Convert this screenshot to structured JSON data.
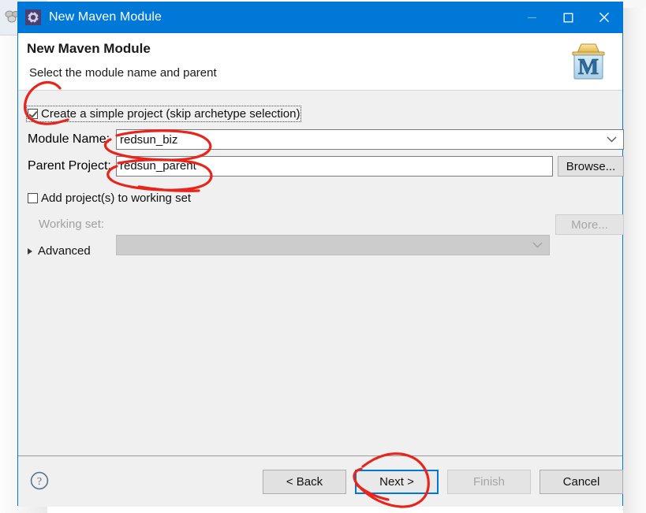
{
  "window": {
    "title": "New Maven Module",
    "title_icon": "gear-icon",
    "minimize_label": "—",
    "maximize_label": "□",
    "close_label": "✕"
  },
  "header": {
    "title": "New Maven Module",
    "subtitle": "Select the module name and parent",
    "logo_letter": "M",
    "logo_name": "maven-logo-icon"
  },
  "form": {
    "simple_project": {
      "label": "Create a simple project (skip archetype selection)",
      "checked": true,
      "focused": true
    },
    "module_name": {
      "label": "Module Name:",
      "value": "redsun_biz"
    },
    "parent_project": {
      "label": "Parent Project:",
      "value": "redsun_parent",
      "browse_label": "Browse..."
    },
    "working_set_checkbox": {
      "label": "Add project(s) to working set",
      "checked": false
    },
    "working_set": {
      "label": "Working set:",
      "value": "",
      "more_label": "More...",
      "enabled": false
    },
    "advanced": {
      "label": "Advanced",
      "expanded": false
    }
  },
  "footer": {
    "help_label": "?",
    "buttons": [
      {
        "label": "< Back",
        "name": "back-button",
        "enabled": true,
        "focused": false
      },
      {
        "label": "Next >",
        "name": "next-button",
        "enabled": true,
        "focused": true
      },
      {
        "label": "Finish",
        "name": "finish-button",
        "enabled": false,
        "focused": false
      },
      {
        "label": "Cancel",
        "name": "cancel-button",
        "enabled": true,
        "focused": false
      }
    ]
  },
  "colors": {
    "titlebar": "#0078d7",
    "accent": "#0078d7",
    "dialog_bg": "#f0f0f0",
    "annotation": "#e8251d"
  },
  "annotations": {
    "color": "#e8251d",
    "marks": [
      {
        "name": "circle-around-simple-project-checkbox",
        "target": "simple-project-checkbox"
      },
      {
        "name": "circle-around-module-name-value",
        "target": "module-name-input"
      },
      {
        "name": "circle-around-parent-project-value",
        "target": "parent-project-input"
      },
      {
        "name": "circle-around-next-button",
        "target": "next-button"
      }
    ]
  }
}
